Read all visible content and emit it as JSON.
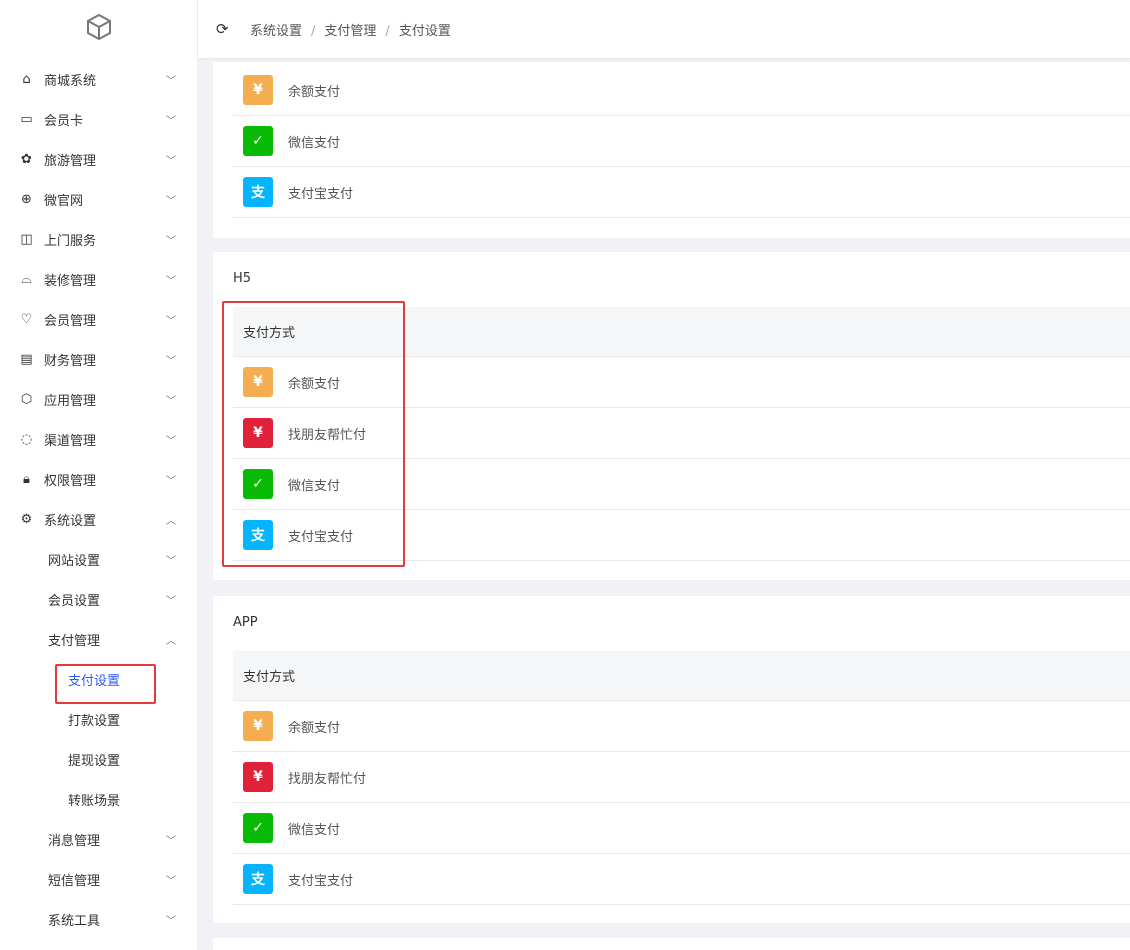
{
  "sidebar": {
    "items": [
      {
        "label": "商城系统",
        "icon": "shopping-bag-icon"
      },
      {
        "label": "会员卡",
        "icon": "member-card-icon"
      },
      {
        "label": "旅游管理",
        "icon": "palm-tree-icon"
      },
      {
        "label": "微官网",
        "icon": "globe-icon"
      },
      {
        "label": "上门服务",
        "icon": "door-icon"
      },
      {
        "label": "装修管理",
        "icon": "decoration-icon"
      },
      {
        "label": "会员管理",
        "icon": "diamond-icon"
      },
      {
        "label": "财务管理",
        "icon": "finance-icon"
      },
      {
        "label": "应用管理",
        "icon": "cube-icon"
      },
      {
        "label": "渠道管理",
        "icon": "channel-icon"
      },
      {
        "label": "权限管理",
        "icon": "lock-icon"
      },
      {
        "label": "系统设置",
        "icon": "gear-icon"
      }
    ],
    "system_sub": [
      {
        "label": "网站设置"
      },
      {
        "label": "会员设置"
      },
      {
        "label": "支付管理"
      }
    ],
    "payment_sub": [
      {
        "label": "支付设置"
      },
      {
        "label": "打款设置"
      },
      {
        "label": "提现设置"
      },
      {
        "label": "转账场景"
      }
    ],
    "system_sub_after": [
      {
        "label": "消息管理"
      },
      {
        "label": "短信管理"
      },
      {
        "label": "系统工具"
      }
    ]
  },
  "header": {
    "breadcrumb": [
      "系统设置",
      "支付管理",
      "支付设置"
    ],
    "sep": "/"
  },
  "sections": [
    {
      "rows": [
        "余额支付",
        "微信支付",
        "支付宝支付"
      ]
    },
    {
      "title": "H5",
      "column": "支付方式",
      "rows": [
        "余额支付",
        "找朋友帮忙付",
        "微信支付",
        "支付宝支付"
      ]
    },
    {
      "title": "APP",
      "column": "支付方式",
      "rows": [
        "余额支付",
        "找朋友帮忙付",
        "微信支付",
        "支付宝支付"
      ]
    }
  ],
  "icons": {
    "余额支付": "¥",
    "找朋友帮忙付": "¥",
    "微信支付": "✓",
    "支付宝支付": "支"
  },
  "colors": {
    "balance": "#f5ae4f",
    "friend": "#e0213a",
    "wechat": "#09bb07",
    "alipay": "#06b4fd",
    "active": "#2d5cf6",
    "highlight": "#e5393b"
  }
}
